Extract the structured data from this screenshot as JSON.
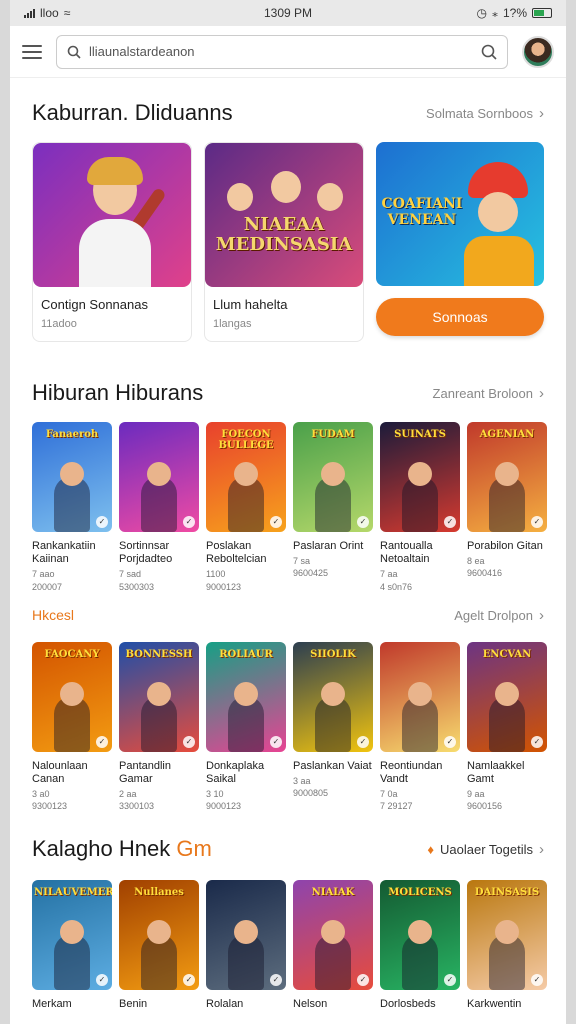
{
  "status": {
    "carrier": "lloo",
    "time": "1309 PM",
    "battery": "1?%"
  },
  "search": {
    "value": "lliaunalstardeanon"
  },
  "section1": {
    "title": "Kaburran. Dliduanns",
    "see_all": "Solmata Sornboos",
    "cards": [
      {
        "art": "",
        "title": "Contign Sonnanas",
        "sub": "11adoo",
        "colors": [
          "#7b2fbf",
          "#e0418a"
        ]
      },
      {
        "art": "NIAEAA MEDINSASIA",
        "title": "Llum hahelta",
        "sub": "1langas",
        "colors": [
          "#5b2a86",
          "#d94c7a"
        ]
      },
      {
        "art": "COAFIANI VENEAN",
        "button": "Sonnoas",
        "colors": [
          "#1d6fd1",
          "#27c2e0"
        ]
      }
    ]
  },
  "section2": {
    "title": "Hiburan Hiburans",
    "see_all": "Zanreant Broloon",
    "games": [
      {
        "art": "Fanaeroh",
        "title": "Rankankatiin Kaiinan",
        "sub1": "7 aao",
        "sub2": "200007",
        "colors": [
          "#2f6fd8",
          "#7ec0ee"
        ]
      },
      {
        "art": "",
        "title": "Sortinnsar Porjdadteo",
        "sub1": "7 sad",
        "sub2": "5300303",
        "colors": [
          "#6b2bbf",
          "#f04ba3"
        ]
      },
      {
        "art": "FOECON BULLEGE",
        "title": "Poslakan Reboltelcian",
        "sub1": "1100",
        "sub2": "9000123",
        "colors": [
          "#e8412d",
          "#f7a21c"
        ]
      },
      {
        "art": "FUDAM",
        "title": "Paslaran Orint",
        "sub1": "7 sa",
        "sub2": "9600425",
        "colors": [
          "#4aa04a",
          "#b5d86a"
        ]
      },
      {
        "art": "SUINATS",
        "title": "Rantoualla Netoaltain",
        "sub1": "7 aa",
        "sub2": "4 s0n76",
        "colors": [
          "#1b1b3a",
          "#d63a2f"
        ]
      },
      {
        "art": "AGENIAN",
        "title": "Porabilon Gitan",
        "sub1": "8 ea",
        "sub2": "9600416",
        "colors": [
          "#c0392b",
          "#f5b041"
        ]
      }
    ]
  },
  "section3": {
    "title": "Hkcesl",
    "see_all": "Agelt Drolpon",
    "games": [
      {
        "art": "FAOCANY",
        "title": "Nalounlaan Canan",
        "sub1": "3 a0",
        "sub2": "9300123",
        "colors": [
          "#d35400",
          "#f39c12"
        ]
      },
      {
        "art": "BONNESSH",
        "title": "Pantandlin Gamar",
        "sub1": "2 aa",
        "sub2": "3300103",
        "colors": [
          "#1f4fa8",
          "#e74c3c"
        ]
      },
      {
        "art": "ROLIAUR",
        "title": "Donkaplaka Saikal",
        "sub1": "3 10",
        "sub2": "9000123",
        "colors": [
          "#16a085",
          "#e84393"
        ]
      },
      {
        "art": "SIIOLIK",
        "title": "Paslankan Vaiat",
        "sub1": "3 aa",
        "sub2": "9000805",
        "colors": [
          "#2c3e50",
          "#f1c40f"
        ]
      },
      {
        "art": "",
        "title": "Reontiundan Vandt",
        "sub1": "7 0a",
        "sub2": "7 29127",
        "colors": [
          "#c0392b",
          "#f7dc6f"
        ]
      },
      {
        "art": "ENCVAN",
        "title": "Namlaakkel Gamt",
        "sub1": "9 aa",
        "sub2": "9600156",
        "colors": [
          "#6c3483",
          "#d35400"
        ]
      }
    ]
  },
  "section4": {
    "title_main": "Kalagho Hnek",
    "title_accent": "Gm",
    "link": "Uaolaer Togetils",
    "games": [
      {
        "art": "NILAUVEMERS",
        "title": "Merkam",
        "colors": [
          "#2471a3",
          "#5dade2"
        ]
      },
      {
        "art": "Nullanes",
        "title": "Benin",
        "colors": [
          "#a04000",
          "#f39c12"
        ]
      },
      {
        "art": "",
        "title": "Rolalan",
        "colors": [
          "#1a2a4a",
          "#5d6d7e"
        ]
      },
      {
        "art": "NIAIAK",
        "title": "Nelson",
        "colors": [
          "#8e44ad",
          "#e74c3c"
        ]
      },
      {
        "art": "MOLICENS",
        "title": "Dorlosbeds",
        "colors": [
          "#145a32",
          "#28b463"
        ]
      },
      {
        "art": "DAINSASIS",
        "title": "Karkwentin",
        "colors": [
          "#b9770e",
          "#f5cba7"
        ]
      }
    ]
  }
}
